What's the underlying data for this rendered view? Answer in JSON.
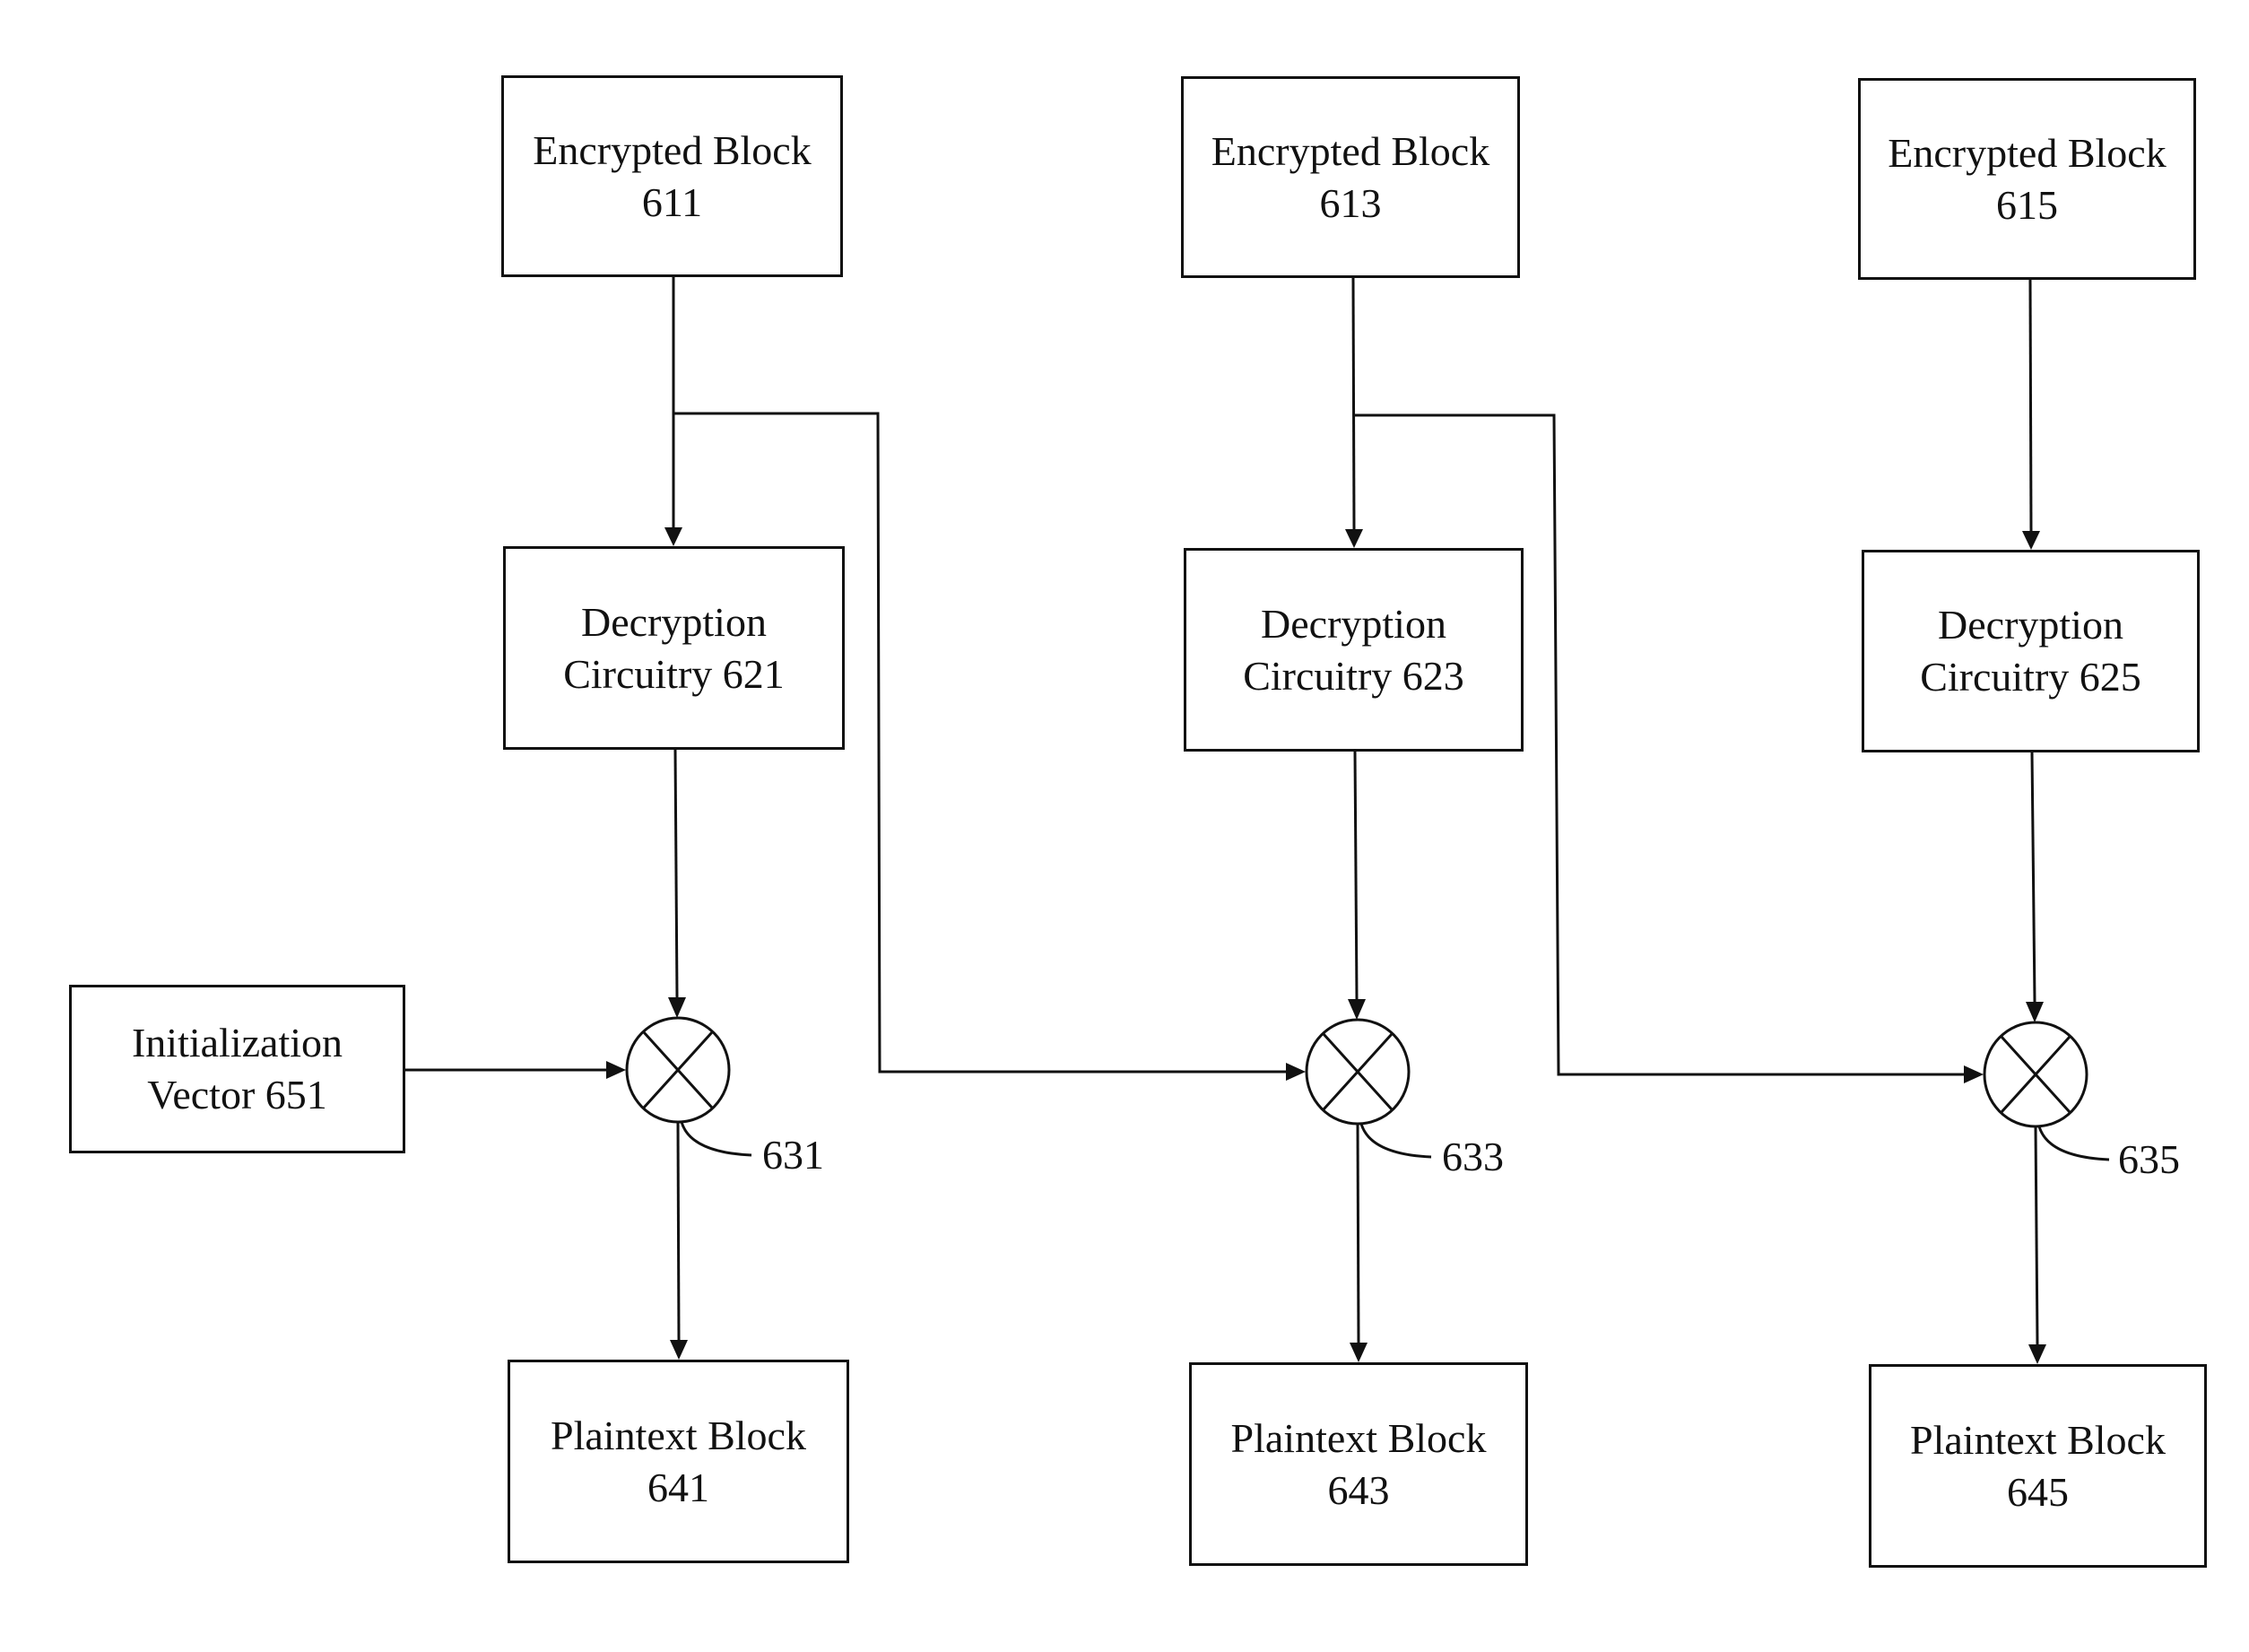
{
  "encrypted_blocks": [
    {
      "line1": "Encrypted Block",
      "line2": "611"
    },
    {
      "line1": "Encrypted Block",
      "line2": "613"
    },
    {
      "line1": "Encrypted Block",
      "line2": "615"
    }
  ],
  "decryption_circuitry": [
    {
      "line1": "Decryption",
      "line2": "Circuitry 621"
    },
    {
      "line1": "Decryption",
      "line2": "Circuitry 623"
    },
    {
      "line1": "Decryption",
      "line2": "Circuitry 625"
    }
  ],
  "initialization_vector": {
    "line1": "Initialization",
    "line2": "Vector 651"
  },
  "xor_labels": [
    "631",
    "633",
    "635"
  ],
  "plaintext_blocks": [
    {
      "line1": "Plaintext Block",
      "line2": "641"
    },
    {
      "line1": "Plaintext Block",
      "line2": "643"
    },
    {
      "line1": "Plaintext Block",
      "line2": "645"
    }
  ],
  "colors": {
    "stroke": "#111111",
    "background": "#ffffff"
  }
}
